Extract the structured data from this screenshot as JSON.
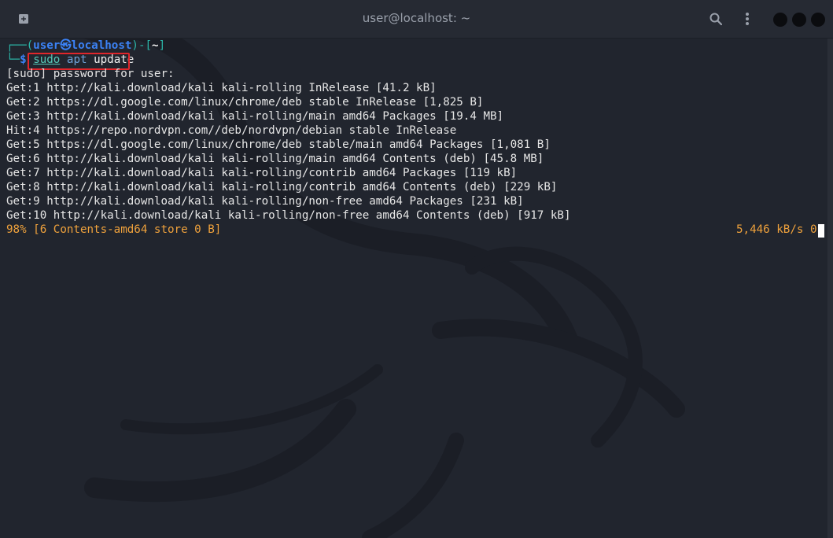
{
  "window": {
    "title": "user@localhost: ~"
  },
  "titlebar": {
    "new_tab_icon": "new-tab-icon",
    "search_icon": "search-icon",
    "menu_icon": "kebab-menu-icon"
  },
  "prompt": {
    "open": "┌──(",
    "user": "user",
    "at": "㉿",
    "host": "localhost",
    "close_dir": ")-[",
    "dir": "~",
    "end": "]",
    "line2_prefix": "└─",
    "dollar": "$"
  },
  "command": {
    "sudo": "sudo",
    "apt": "apt",
    "arg": "update"
  },
  "output": [
    "[sudo] password for user:",
    "Get:1 http://kali.download/kali kali-rolling InRelease [41.2 kB]",
    "Get:2 https://dl.google.com/linux/chrome/deb stable InRelease [1,825 B]",
    "Get:3 http://kali.download/kali kali-rolling/main amd64 Packages [19.4 MB]",
    "Hit:4 https://repo.nordvpn.com//deb/nordvpn/debian stable InRelease",
    "Get:5 https://dl.google.com/linux/chrome/deb stable/main amd64 Packages [1,081 B]",
    "Get:6 http://kali.download/kali kali-rolling/main amd64 Contents (deb) [45.8 MB]",
    "Get:7 http://kali.download/kali kali-rolling/contrib amd64 Packages [119 kB]",
    "Get:8 http://kali.download/kali kali-rolling/contrib amd64 Contents (deb) [229 kB]",
    "Get:9 http://kali.download/kali kali-rolling/non-free amd64 Packages [231 kB]",
    "Get:10 http://kali.download/kali kali-rolling/non-free amd64 Contents (deb) [917 kB]"
  ],
  "progress": {
    "left": "98% [6 Contents-amd64 store 0 B]",
    "right": "5,446 kB/s 0s"
  },
  "colors": {
    "prompt_blue": "#3b82f6",
    "prompt_teal": "#2bb5a8",
    "progress_orange": "#f0a23c",
    "highlight_red": "#e0262b"
  }
}
